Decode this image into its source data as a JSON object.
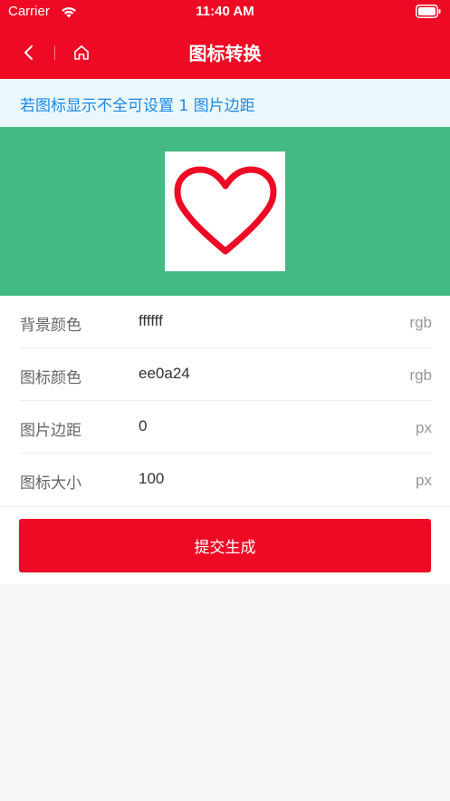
{
  "status_bar": {
    "carrier": "Carrier",
    "time": "11:40 AM"
  },
  "nav": {
    "title": "图标转换",
    "back_icon": "chevron-left-icon",
    "home_icon": "home-icon"
  },
  "notice": {
    "text": "若图标显示不全可设置 1 图片边距"
  },
  "preview": {
    "background_color": "#43b983",
    "tile_color": "#ffffff",
    "icon": "heart-outline-icon",
    "icon_color": "#ee0a24"
  },
  "form": {
    "rows": [
      {
        "label": "背景颜色",
        "value": "ffffff",
        "unit": "rgb"
      },
      {
        "label": "图标颜色",
        "value": "ee0a24",
        "unit": "rgb"
      },
      {
        "label": "图片边距",
        "value": "0",
        "unit": "px"
      },
      {
        "label": "图标大小",
        "value": "100",
        "unit": "px"
      }
    ],
    "submit_label": "提交生成"
  },
  "colors": {
    "brand": "#ee0a24",
    "notice_text": "#1989e6",
    "notice_bg": "#ecf7fd"
  }
}
